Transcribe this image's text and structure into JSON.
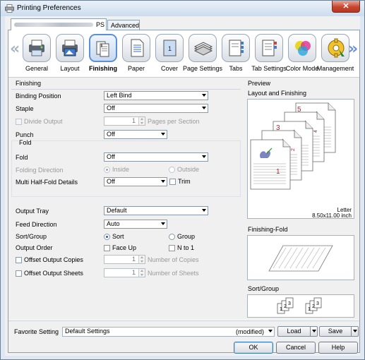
{
  "window": {
    "title": "Printing Preferences",
    "close_label": "✕"
  },
  "tabs": [
    {
      "label": "PS"
    },
    {
      "label": "Advanced"
    }
  ],
  "ribbon": {
    "items": [
      {
        "label": "General",
        "icon": "general-icon"
      },
      {
        "label": "Layout",
        "icon": "layout-icon"
      },
      {
        "label": "Finishing",
        "icon": "finishing-icon",
        "selected": true
      },
      {
        "label": "Paper",
        "icon": "paper-icon"
      },
      {
        "label": "Cover",
        "icon": "cover-icon"
      },
      {
        "label": "Page Settings",
        "icon": "page-settings-icon"
      },
      {
        "label": "Tabs",
        "icon": "tabs-icon"
      },
      {
        "label": "Tab Settings",
        "icon": "tab-settings-icon"
      },
      {
        "label": "Color Mode",
        "icon": "color-mode-icon"
      },
      {
        "label": "Management",
        "icon": "management-icon"
      }
    ]
  },
  "finishing": {
    "section_label": "Finishing",
    "binding_position": {
      "label": "Binding Position",
      "value": "Left Bind"
    },
    "staple": {
      "label": "Staple",
      "value": "Off"
    },
    "divide_output": {
      "label": "Divide Output",
      "value": "1",
      "unit": "Pages per Section"
    },
    "punch": {
      "label": "Punch",
      "value": "Off"
    },
    "fold_section_label": "Fold",
    "fold": {
      "label": "Fold",
      "value": "Off"
    },
    "folding_direction": {
      "label": "Folding Direction",
      "inside": "Inside",
      "outside": "Outside"
    },
    "multi_half_fold": {
      "label": "Multi Half-Fold Details",
      "value": "Off",
      "trim": "Trim"
    },
    "output_tray": {
      "label": "Output Tray",
      "value": "Default"
    },
    "feed_direction": {
      "label": "Feed Direction",
      "value": "Auto"
    },
    "sort_group": {
      "label": "Sort/Group",
      "sort": "Sort",
      "group": "Group"
    },
    "output_order": {
      "label": "Output Order",
      "face_up": "Face Up",
      "n_to_1": "N to 1"
    },
    "offset_copies": {
      "label": "Offset Output Copies",
      "value": "1",
      "unit": "Number of Copies"
    },
    "offset_sheets": {
      "label": "Offset Output Sheets",
      "value": "1",
      "unit": "Number of Sheets"
    }
  },
  "preview": {
    "section_label": "Preview",
    "layout_label": "Layout and Finishing",
    "paper_name": "Letter",
    "paper_size": "8.50x11.00 inch",
    "page_numbers": [
      "5",
      "4",
      "3",
      "2",
      "1"
    ],
    "fold_label": "Finishing-Fold",
    "sort_label": "Sort/Group",
    "sort_numbers": [
      "1",
      "2",
      "3"
    ]
  },
  "favorite": {
    "label": "Favorite Setting",
    "value": "Default Settings",
    "status": "(modified)",
    "load_label": "Load",
    "save_label": "Save"
  },
  "dialog": {
    "ok": "OK",
    "cancel": "Cancel",
    "help": "Help"
  },
  "colors": {
    "accent_selected": "#5d8fd8",
    "page_number_red": "#c0202a"
  }
}
